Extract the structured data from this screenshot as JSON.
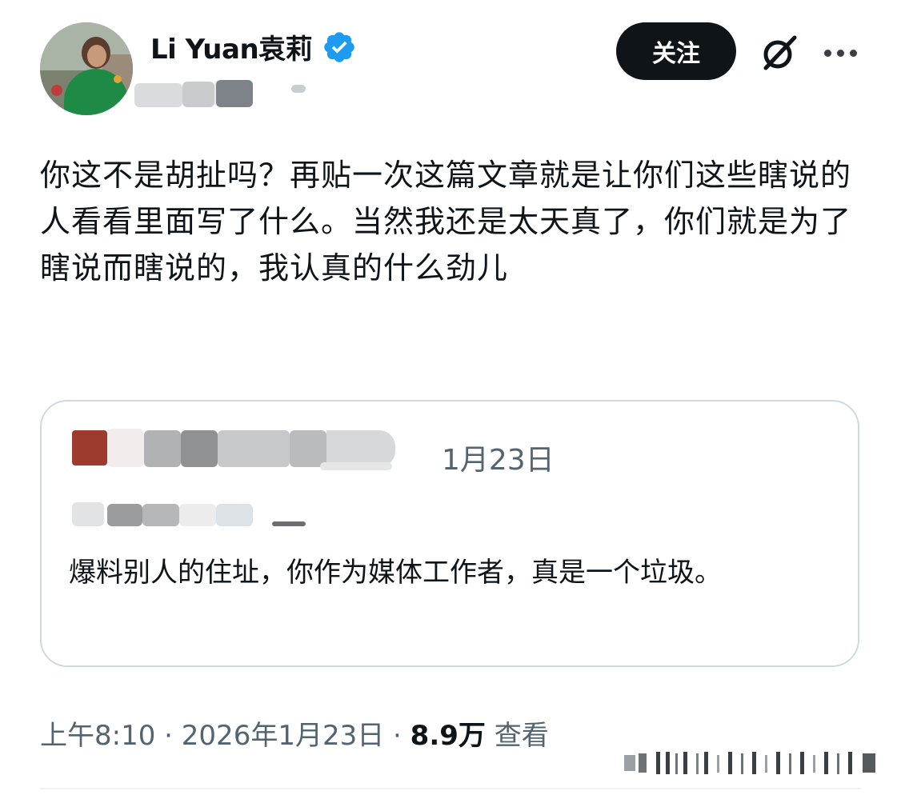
{
  "author": {
    "display_name": "Li Yuan袁莉"
  },
  "header": {
    "follow_label": "关注"
  },
  "tweet": {
    "text": "你这不是胡扯吗？再贴一次这篇文章就是让你们这些瞎说的人看看里面写了什么。当然我还是太天真了，你们就是为了瞎说而瞎说的，我认真的什么劲儿"
  },
  "quote": {
    "date": "1月23日",
    "text": "爆料别人的住址，你作为媒体工作者，真是一个垃圾。"
  },
  "meta": {
    "time": "上午8:10",
    "separator": "·",
    "date": "2026年1月23日",
    "views": "8.9万",
    "views_label": "查看"
  },
  "colors": {
    "follow_button_bg": "#0f1419",
    "verified_blue": "#1d9bf0",
    "secondary_text": "#536471",
    "border": "#cfd9de"
  },
  "icons": [
    "verified-badge-icon",
    "grok-icon",
    "more-options-icon"
  ]
}
